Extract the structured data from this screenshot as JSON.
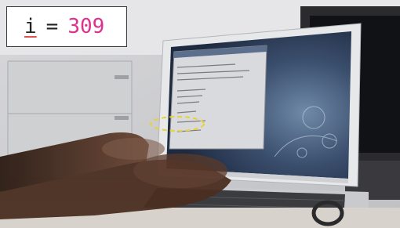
{
  "overlay": {
    "variable": "i",
    "equals": "=",
    "value": "309",
    "value_color": "#e0308f"
  },
  "scene": {
    "description_icon": "laptop-typing-photo",
    "highlight_color": "#e8d23a"
  }
}
